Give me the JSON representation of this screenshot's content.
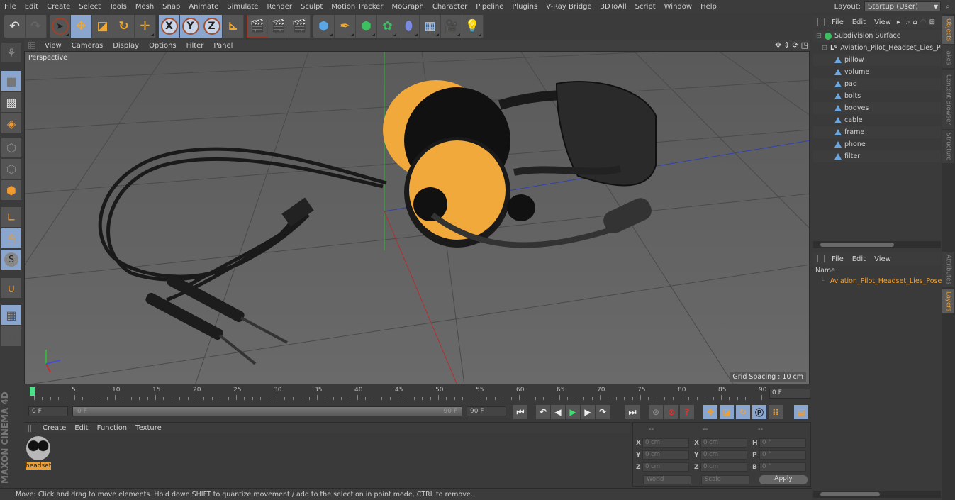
{
  "menubar": {
    "items": [
      "File",
      "Edit",
      "Create",
      "Select",
      "Tools",
      "Mesh",
      "Snap",
      "Animate",
      "Simulate",
      "Render",
      "Sculpt",
      "Motion Tracker",
      "MoGraph",
      "Character",
      "Pipeline",
      "Plugins",
      "V-Ray Bridge",
      "3DToAll",
      "Script",
      "Window",
      "Help"
    ],
    "layout_label": "Layout:",
    "layout_value": "Startup (User)"
  },
  "toolbar": {
    "undo": "undo-icon",
    "redo": "redo-icon",
    "tools": [
      "live-selection",
      "move",
      "scale",
      "rotate",
      "last-tool"
    ],
    "axes": [
      "X",
      "Y",
      "Z"
    ],
    "coord_system": "world-coordinate-icon",
    "render_tools": [
      "render-view",
      "render-picture-viewer",
      "render-settings"
    ],
    "create_tools": [
      "cube",
      "pen",
      "subdivision-surface",
      "cloner",
      "deformer",
      "floor",
      "camera",
      "light"
    ]
  },
  "viewport": {
    "menu": [
      "View",
      "Cameras",
      "Display",
      "Options",
      "Filter",
      "Panel"
    ],
    "camera_label": "Perspective",
    "grid_spacing": "Grid Spacing : 10 cm"
  },
  "timeline": {
    "ticks": [
      "0",
      "5",
      "10",
      "15",
      "20",
      "25",
      "30",
      "35",
      "40",
      "45",
      "50",
      "55",
      "60",
      "65",
      "70",
      "75",
      "80",
      "85",
      "90"
    ],
    "current_frame": "0 F",
    "start_frame": "0 F",
    "range_start": "0 F",
    "range_end": "90 F",
    "end_frame": "90 F"
  },
  "material_panel": {
    "menu": [
      "Create",
      "Edit",
      "Function",
      "Texture"
    ],
    "materials": [
      {
        "name": "headset"
      }
    ]
  },
  "coordinates": {
    "headers": [
      "--",
      "--",
      "--"
    ],
    "position": [
      {
        "axis": "X",
        "value": "0 cm"
      },
      {
        "axis": "Y",
        "value": "0 cm"
      },
      {
        "axis": "Z",
        "value": "0 cm"
      }
    ],
    "size": [
      {
        "axis": "X",
        "value": "0 cm"
      },
      {
        "axis": "Y",
        "value": "0 cm"
      },
      {
        "axis": "Z",
        "value": "0 cm"
      }
    ],
    "rotation": [
      {
        "axis": "H",
        "value": "0 °"
      },
      {
        "axis": "P",
        "value": "0 °"
      },
      {
        "axis": "B",
        "value": "0 °"
      }
    ],
    "mode_world": "World",
    "mode_scale": "Scale",
    "apply_label": "Apply"
  },
  "object_manager": {
    "menu": [
      "File",
      "Edit",
      "View"
    ],
    "tree": [
      {
        "name": "Subdivision Surface",
        "level": 0,
        "icon": "subdivision-icon"
      },
      {
        "name": "Aviation_Pilot_Headset_Lies_Pose",
        "level": 1,
        "icon": "null-icon"
      },
      {
        "name": "pillow",
        "level": 2,
        "icon": "polygon-icon"
      },
      {
        "name": "volume",
        "level": 2,
        "icon": "polygon-icon"
      },
      {
        "name": "pad",
        "level": 2,
        "icon": "polygon-icon"
      },
      {
        "name": "bolts",
        "level": 2,
        "icon": "polygon-icon"
      },
      {
        "name": "bodyes",
        "level": 2,
        "icon": "polygon-icon"
      },
      {
        "name": "cable",
        "level": 2,
        "icon": "polygon-icon"
      },
      {
        "name": "frame",
        "level": 2,
        "icon": "polygon-icon"
      },
      {
        "name": "phone",
        "level": 2,
        "icon": "polygon-icon"
      },
      {
        "name": "filter",
        "level": 2,
        "icon": "polygon-icon"
      }
    ]
  },
  "layer_manager": {
    "menu": [
      "File",
      "Edit",
      "View"
    ],
    "column_name": "Name",
    "layers": [
      {
        "name": "Aviation_Pilot_Headset_Lies_Pose",
        "color": "#e07020"
      }
    ]
  },
  "side_tabs": {
    "top": [
      {
        "label": "Objects",
        "active": true
      },
      {
        "label": "Takes",
        "active": false
      },
      {
        "label": "Content Browser",
        "active": false
      },
      {
        "label": "Structure",
        "active": false
      }
    ],
    "bottom": [
      {
        "label": "Attributes",
        "active": false
      },
      {
        "label": "Layers",
        "active": true
      }
    ]
  },
  "branding": "MAXON CINEMA 4D",
  "status_bar": "Move: Click and drag to move elements. Hold down SHIFT to quantize movement / add to the selection in point mode, CTRL to remove.",
  "colors": {
    "accent": "#f0a030",
    "selected_tool": "#8aa6cf",
    "headset_yellow": "#f2a93b"
  }
}
